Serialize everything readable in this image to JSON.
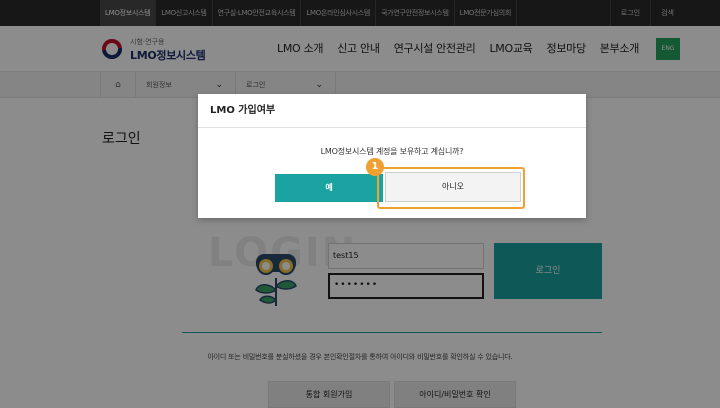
{
  "topbar": {
    "links": [
      "LMO정보시스템",
      "LMO신고시스템",
      "연구실·LMO안전교육시스템",
      "LMO온라인심사시스템",
      "국가연구안전정보시스템",
      "LMO전문가심의회"
    ],
    "active_index": 0,
    "login": "로그인",
    "search": "검색"
  },
  "header": {
    "logo_sub": "시험·연구용",
    "logo_main": "LMO정보시스템",
    "nav": [
      "LMO 소개",
      "신고 안내",
      "연구시설 안전관리",
      "LMO교육",
      "정보마당",
      "본부소개"
    ],
    "eng": "ENG"
  },
  "breadcrumb": {
    "home_icon": "home-icon",
    "level1": "회원정보",
    "level2": "로그인"
  },
  "page": {
    "title": "로그인"
  },
  "login": {
    "watermark": "LOGIN",
    "id_value": "test15",
    "pw_value": "•••••••",
    "login_button": "로그인",
    "notice": "아이디 또는 비밀번호를 분실하셨을 경우 본인확인절차를 통하여 아이디와 비밀번호를 확인하실 수 있습니다.",
    "join_button": "통합 회원가입",
    "find_button": "아이디/비밀번호 확인"
  },
  "modal": {
    "title": "LMO 가입여부",
    "message": "LMO정보시스템 계정을 보유하고 계십니까?",
    "yes": "예",
    "no": "아니오"
  },
  "annotation": {
    "step": "1"
  },
  "colors": {
    "teal": "#1aa3a0",
    "highlight": "#f0a030",
    "eng_green": "#27a060"
  }
}
